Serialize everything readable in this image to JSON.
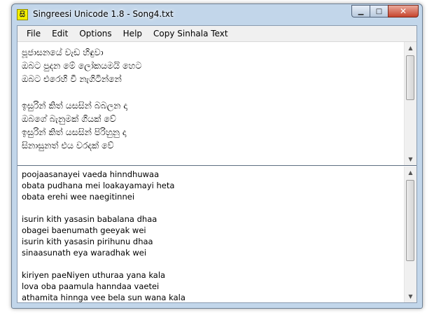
{
  "window": {
    "title": "Singreesi Unicode 1.8 - Song4.txt",
    "app_icon_glyph": "සි",
    "minimize_glyph": "▁",
    "maximize_glyph": "□",
    "close_glyph": "✕"
  },
  "menu": {
    "items": [
      "File",
      "Edit",
      "Options",
      "Help",
      "Copy Sinhala Text"
    ]
  },
  "sinhala_pane": {
    "lines": [
      "පූජාසනයේ වැඩ හිඳුවා",
      "ඔබට පුදන මේ ලෝකයමයි හෙට",
      "ඔබට එරෙහි වී නැගිටින්නේ",
      "",
      "ඉසුරින් කිත් යසසින් බබලන දා",
      "ඔබගේ බැනුමක් ගියක් වේ",
      "ඉසුරින් කිත් යසසින් පිරිහුනු දා",
      "සිනාසුනත් එය වරදක් වේ"
    ]
  },
  "roman_pane": {
    "lines": [
      "poojaasanayei vaeda hinndhuwaa",
      "obata pudhana mei loakayamayi heta",
      "obata erehi wee naegitinnei",
      "",
      "isurin kith yasasin babalana dhaa",
      "obagei baenumath geeyak wei",
      "isurin kith yasasin pirihunu dhaa",
      "sinaasunath eya waradhak wei",
      "",
      "kiriyen paeNiyen uthuraa yana kala",
      "lova oba paamula hanndaa vaetei",
      "athamita hinnga vee bela sun wana kala"
    ]
  },
  "scrollbar": {
    "up_glyph": "▲",
    "down_glyph": "▼"
  },
  "colors": {
    "frame": "#c2d6ea",
    "close_button": "#c7442d",
    "app_icon": "#f2ee00"
  }
}
